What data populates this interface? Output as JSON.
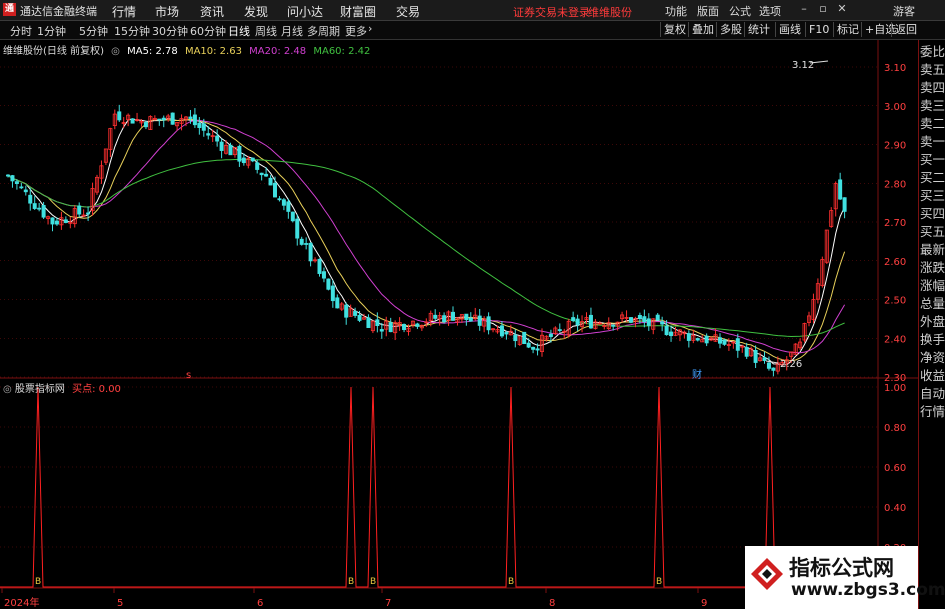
{
  "titlebar": {
    "app_title": "通达信金融终端",
    "logo_char": "通",
    "menu": [
      "行情",
      "市场",
      "资讯",
      "发现",
      "问小达",
      "财富圈",
      "交易"
    ],
    "status_left": "证券交易未登录",
    "status_right": "维维股份",
    "right_menu": [
      "功能",
      "版面",
      "公式",
      "选项"
    ],
    "guest": "游客"
  },
  "toolbar": {
    "tabs": [
      "分时",
      "1分钟",
      "5分钟",
      "15分钟",
      "30分钟",
      "60分钟",
      "日线",
      "周线",
      "月线",
      "多周期",
      "更多"
    ],
    "active_tab": "日线",
    "right_buttons": [
      "复权",
      "叠加",
      "多股",
      "统计",
      "画线",
      "F10",
      "标记",
      "+自选",
      "返回"
    ]
  },
  "main_chart": {
    "stock_title": "维维股份(日线 前复权)",
    "ma_labels": [
      {
        "text": "MA5: 2.78",
        "color": "#ffffff"
      },
      {
        "text": "MA10: 2.63",
        "color": "#e8d05a"
      },
      {
        "text": "MA20: 2.48",
        "color": "#d040d0"
      },
      {
        "text": "MA60: 2.42",
        "color": "#40c040"
      }
    ],
    "y_ticks": [
      "3.10",
      "3.00",
      "2.90",
      "2.80",
      "2.70",
      "2.60",
      "2.50",
      "2.40",
      "2.30"
    ],
    "high_label": "3.12",
    "low_label": "2.26",
    "marker_s": "s",
    "marker_cai": "财"
  },
  "indicator": {
    "name": "股票指标网",
    "signal_label": "买点: 0.00",
    "y_ticks": [
      "1.00",
      "0.80",
      "0.60",
      "0.40",
      "0.20"
    ],
    "buy_marker": "B",
    "spike_count": 6
  },
  "x_axis": [
    "2024年",
    "5",
    "6",
    "7",
    "8",
    "9"
  ],
  "sidebar": [
    "委比",
    "卖五",
    "卖四",
    "卖三",
    "卖二",
    "卖一",
    "买一",
    "买二",
    "买三",
    "买四",
    "买五",
    "最新",
    "涨跌",
    "涨幅",
    "总量",
    "外盘",
    "换手",
    "净资",
    "收益",
    "自动",
    "行情"
  ],
  "watermark": {
    "line1": "指标公式网",
    "line2": "www.zbgs3.com"
  },
  "colors": {
    "up": "#ff3030",
    "down": "#40e0e0",
    "grid": "#7a1010",
    "axis_text": "#ff4040"
  }
}
